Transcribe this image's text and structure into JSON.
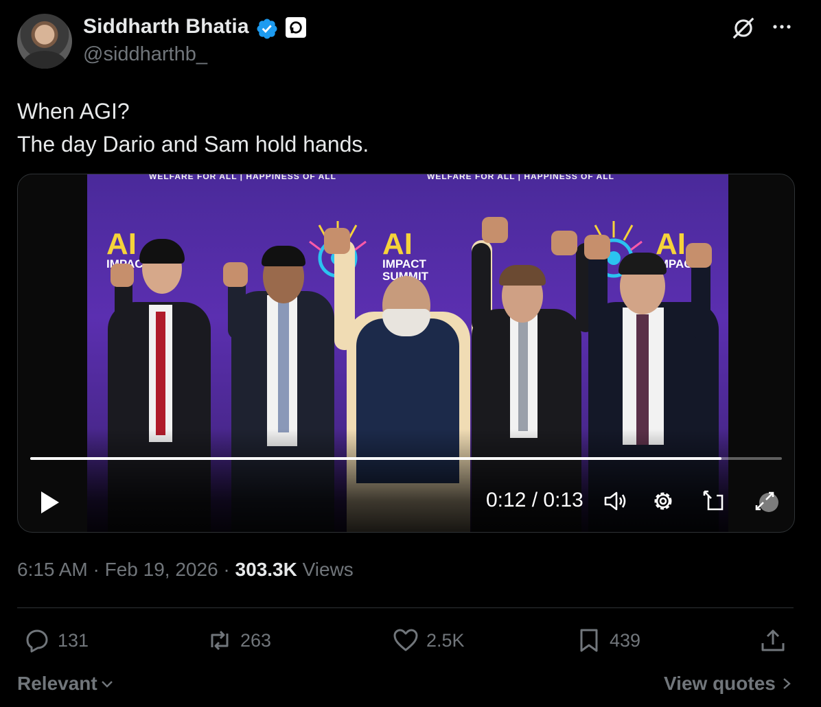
{
  "author": {
    "name": "Siddharth Bhatia",
    "handle": "@siddharthb_",
    "verified": true,
    "verified_color": "#1d9bf0"
  },
  "tweet": {
    "lines": [
      "When AGI?",
      "The day Dario and Sam hold hands."
    ]
  },
  "video": {
    "current_time": "0:12",
    "separator": " / ",
    "duration": "0:13",
    "progress_fraction": 0.92,
    "banner_left": "WELFARE FOR ALL | HAPPINESS OF ALL",
    "banner_right": "WELFARE FOR ALL | HAPPINESS OF ALL",
    "logo_main": "AI",
    "logo_sub_1": "IMPACT",
    "logo_sub_2": "SUMMIT",
    "controls": [
      "play-icon",
      "volume-icon",
      "settings-icon",
      "pip-icon",
      "fullscreen-icon"
    ]
  },
  "meta": {
    "time": "6:15 AM",
    "dot": " · ",
    "date": "Feb 19, 2026",
    "views_count": "303.3K",
    "views_label": "Views"
  },
  "actions": {
    "replies": "131",
    "retweets": "263",
    "likes": "2.5K",
    "bookmarks": "439"
  },
  "footer": {
    "sort_label": "Relevant",
    "quotes_label": "View quotes"
  },
  "colors": {
    "background": "#000000",
    "text_primary": "#e7e9ea",
    "text_secondary": "#71767b",
    "divider": "#2f3336"
  }
}
